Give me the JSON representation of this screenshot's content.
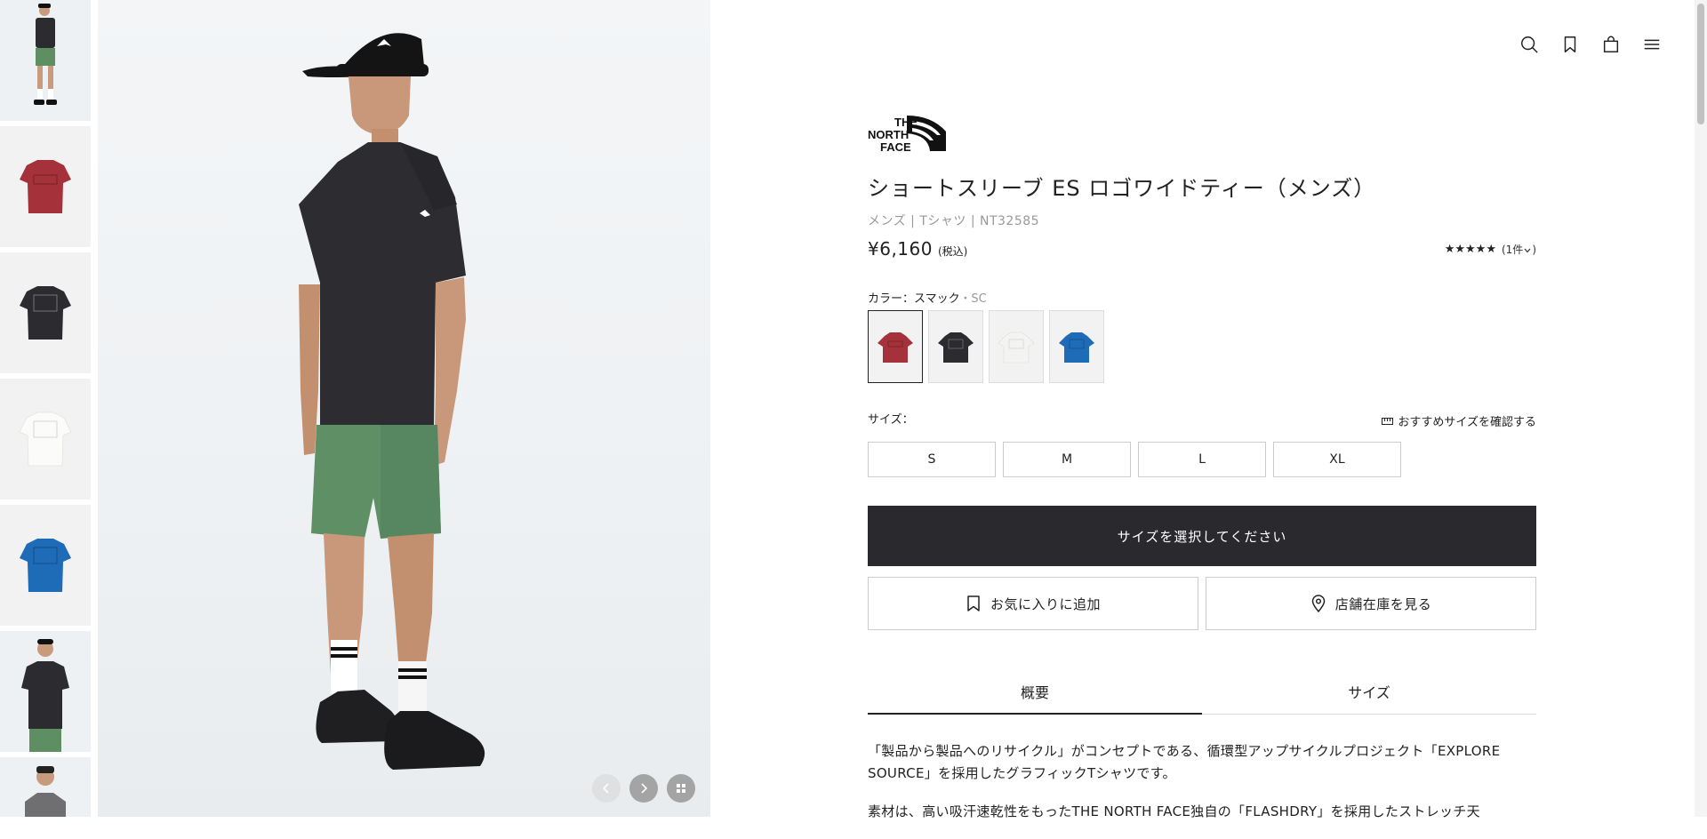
{
  "header": {
    "icons": [
      "search-icon",
      "bookmark-icon",
      "bag-icon",
      "menu-icon"
    ]
  },
  "gallery": {
    "thumbnails": [
      {
        "name": "model-full-body",
        "shirt": "#2b2b30"
      },
      {
        "name": "tee-red-back",
        "shirt": "#a5323a"
      },
      {
        "name": "tee-black-back",
        "shirt": "#2b2b30"
      },
      {
        "name": "tee-white-back",
        "shirt": "#f3f3f1"
      },
      {
        "name": "tee-blue-back",
        "shirt": "#1e6bb8"
      },
      {
        "name": "model-front",
        "shirt": "#2b2b30"
      },
      {
        "name": "model-portrait",
        "shirt": "#6f6f72"
      }
    ],
    "controls": [
      "prev-arrow-icon",
      "next-arrow-icon",
      "grid-icon"
    ]
  },
  "brand": {
    "logo_text_lines": [
      "THE",
      "NORTH",
      "FACE"
    ]
  },
  "product": {
    "title": "ショートスリーブ ES ロゴワイドティー（メンズ）",
    "meta": "メンズ | Tシャツ | NT32585",
    "price": "¥6,160",
    "tax_note": "(税込)",
    "rating_stars": "★★★★★",
    "rating_count": "(1件",
    "color_label": "カラー：スマック",
    "color_code": "・SC",
    "swatches": [
      {
        "color": "#a5323a",
        "selected": true
      },
      {
        "color": "#2b2b30",
        "selected": false
      },
      {
        "color": "#f3f3f1",
        "selected": false
      },
      {
        "color": "#1e6bb8",
        "selected": false
      }
    ],
    "size_label": "サイズ：",
    "size_guide": "おすすめサイズを確認する",
    "sizes": [
      "S",
      "M",
      "L",
      "XL"
    ],
    "cta": "サイズを選択してください",
    "favorite": "お気に入りに追加",
    "store_stock": "店舗在庫を見る"
  },
  "tabs": [
    {
      "label": "概要",
      "active": true
    },
    {
      "label": "サイズ",
      "active": false
    }
  ],
  "description": {
    "p1": "「製品から製品へのリサイクル」がコンセプトである、循環型アップサイクルプロジェクト「EXPLORE SOURCE」を採用したグラフィックTシャツです。",
    "p2": "素材は、高い吸汗速乾性をもったTHE NORTH FACE独自の「FLASHDRY」を採用したストレッチ天"
  }
}
